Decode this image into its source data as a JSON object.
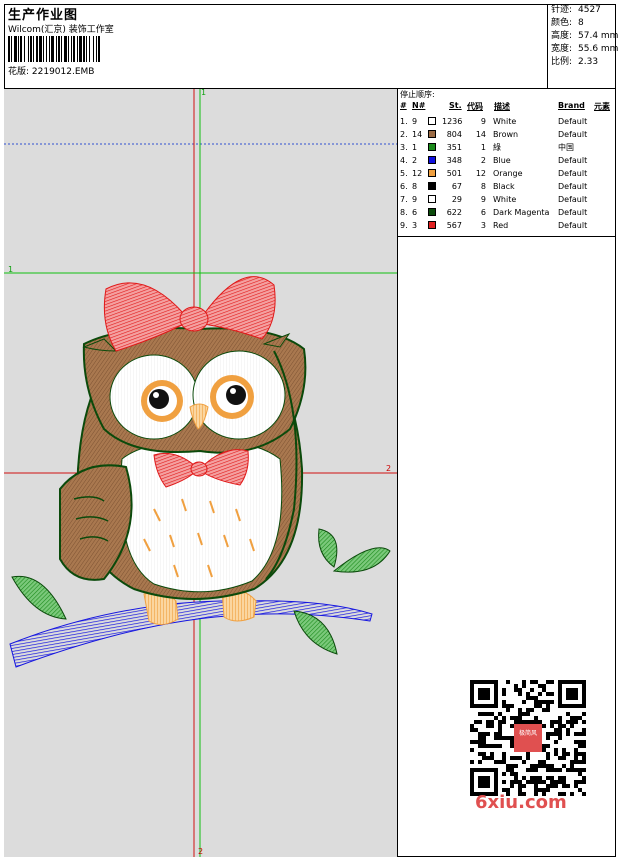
{
  "header": {
    "title": "生产作业图",
    "subtitle": "Wilcom(汇京) 装饰工作室",
    "filename": "花版: 2219012.EMB"
  },
  "stats": [
    {
      "label": "针迹:",
      "value": "4527"
    },
    {
      "label": "颜色:",
      "value": "8"
    },
    {
      "label": "高度:",
      "value": "57.4 mm"
    },
    {
      "label": "宽度:",
      "value": "55.6 mm"
    },
    {
      "label": "比例:",
      "value": "2.33"
    }
  ],
  "legend": {
    "title": "停止顺序:",
    "headers": {
      "num": "#",
      "n": "N#",
      "st": "St.",
      "code": "代码",
      "desc": "描述",
      "brand": "Brand",
      "element": "元素"
    },
    "rows": [
      {
        "num": "1.",
        "n": "9",
        "color": "#ffffff",
        "st": "1236",
        "code": "9",
        "desc": "White",
        "brand": "Default"
      },
      {
        "num": "2.",
        "n": "14",
        "color": "#9b6b45",
        "st": "804",
        "code": "14",
        "desc": "Brown",
        "brand": "Default"
      },
      {
        "num": "3.",
        "n": "1",
        "color": "#1a8a1a",
        "st": "351",
        "code": "1",
        "desc": "綠",
        "brand": "中国"
      },
      {
        "num": "4.",
        "n": "2",
        "color": "#1010e0",
        "st": "348",
        "code": "2",
        "desc": "Blue",
        "brand": "Default"
      },
      {
        "num": "5.",
        "n": "12",
        "color": "#f0a040",
        "st": "501",
        "code": "12",
        "desc": "Orange",
        "brand": "Default"
      },
      {
        "num": "6.",
        "n": "8",
        "color": "#000000",
        "st": "67",
        "code": "8",
        "desc": "Black",
        "brand": "Default"
      },
      {
        "num": "7.",
        "n": "9",
        "color": "#ffffff",
        "st": "29",
        "code": "9",
        "desc": "White",
        "brand": "Default"
      },
      {
        "num": "8.",
        "n": "6",
        "color": "#0b4a0b",
        "st": "622",
        "code": "6",
        "desc": "Dark Magenta",
        "brand": "Default"
      },
      {
        "num": "9.",
        "n": "3",
        "color": "#e02020",
        "st": "567",
        "code": "3",
        "desc": "Red",
        "brand": "Default"
      }
    ]
  },
  "canvas": {
    "marks": {
      "top": "1",
      "left": "1",
      "right": "2",
      "bottom": "2"
    },
    "colors": {
      "background": "#dcdcdc",
      "axis_red": "#d01010",
      "axis_green": "#10c010",
      "guide_blue": "#2040c0"
    }
  },
  "qr": {
    "label": "极简风",
    "site": "6xiu.com"
  }
}
